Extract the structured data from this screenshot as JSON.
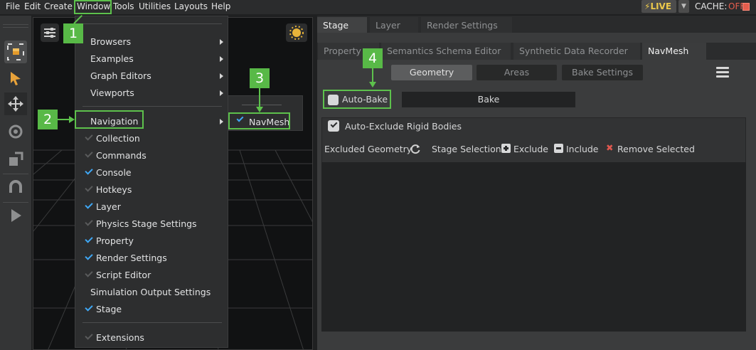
{
  "menubar": {
    "items": [
      "File",
      "Edit",
      "Create",
      "Window",
      "Tools",
      "Utilities",
      "Layouts",
      "Help"
    ],
    "live_label": "LIVE",
    "cache_label": "CACHE:",
    "cache_state": "OFF"
  },
  "window_menu": {
    "submenus": [
      "Browsers",
      "Examples",
      "Graph Editors",
      "Viewports"
    ],
    "navigation_label": "Navigation",
    "panels": [
      {
        "label": "Collection",
        "checked": false
      },
      {
        "label": "Commands",
        "checked": false
      },
      {
        "label": "Console",
        "checked": true
      },
      {
        "label": "Hotkeys",
        "checked": false
      },
      {
        "label": "Layer",
        "checked": true
      },
      {
        "label": "Physics Stage Settings",
        "checked": false
      },
      {
        "label": "Property",
        "checked": true
      },
      {
        "label": "Render Settings",
        "checked": true
      },
      {
        "label": "Script Editor",
        "checked": false
      }
    ],
    "simulation_output": "Simulation Output Settings",
    "stage": "Stage",
    "extensions": "Extensions"
  },
  "navigation_submenu": {
    "navmesh_label": "NavMesh"
  },
  "panel_tabs_top": [
    "Stage",
    "Layer",
    "Render Settings"
  ],
  "panel_tabs_second": [
    "Property",
    "Semantics Schema Editor",
    "Synthetic Data Recorder",
    "NavMesh"
  ],
  "navmesh": {
    "modes": [
      "Geometry",
      "Areas",
      "Bake Settings"
    ],
    "auto_bake_label": "Auto-Bake",
    "bake_label": "Bake",
    "auto_exclude_label": "Auto-Exclude Rigid Bodies",
    "excluded_geometry_label": "Excluded Geometry",
    "stage_selection_label": "Stage Selection:",
    "exclude_label": "Exclude",
    "include_label": "Include",
    "remove_selected_label": "Remove Selected"
  },
  "annotations": [
    "1",
    "2",
    "3",
    "4"
  ],
  "colors": {
    "accent": "#3fa7f4",
    "annotation": "#5dc14c",
    "live": "#ecc94b",
    "cache_off": "#e45d4d"
  }
}
